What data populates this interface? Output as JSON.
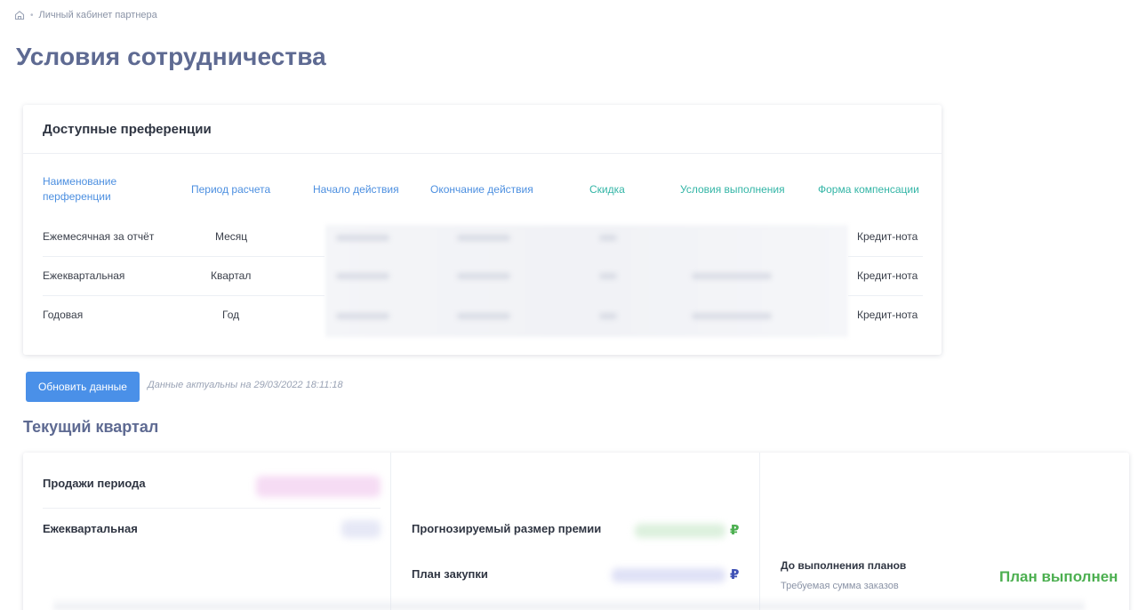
{
  "breadcrumb": {
    "home_icon": "home-icon",
    "current": "Личный кабинет партнера"
  },
  "page_title": "Условия сотрудничества",
  "preferences": {
    "title": "Доступные преференции",
    "columns": {
      "name_line1": "Наименование",
      "name_line2": "перференции",
      "period": "Период расчета",
      "start": "Начало действия",
      "end": "Окончание действия",
      "discount": "Скидка",
      "conditions": "Условия выполнения",
      "compensation": "Форма компенсации"
    },
    "rows": [
      {
        "name": "Ежемесячная за отчёт",
        "period": "Месяц",
        "compensation": "Кредит-нота"
      },
      {
        "name": "Ежеквартальная",
        "period": "Квартал",
        "compensation": "Кредит-нота"
      },
      {
        "name": "Годовая",
        "period": "Год",
        "compensation": "Кредит-нота"
      }
    ],
    "colors": {
      "header_blue": "#4c8fe0",
      "header_teal": "#33b5a6"
    }
  },
  "refresh": {
    "button_label": "Обновить данные",
    "updated_note": "Данные актуальны на 29/03/2022 18:11:18"
  },
  "current_quarter": {
    "title": "Текущий квартал",
    "sales_period_label": "Продажи периода",
    "quarterly_label": "Ежеквартальная",
    "forecast_bonus_label": "Прогнозируемый размер премии",
    "purchase_plan_label": "План закупки",
    "currency_symbol": "₽",
    "until_plans_label": "До выполнения планов",
    "required_sum_label": "Требуемая сумма заказов",
    "plan_status": "План выполнен",
    "colors": {
      "forecast_rub": "#4caf50",
      "plan_rub": "#3f51b5",
      "status": "#4caf50"
    }
  }
}
